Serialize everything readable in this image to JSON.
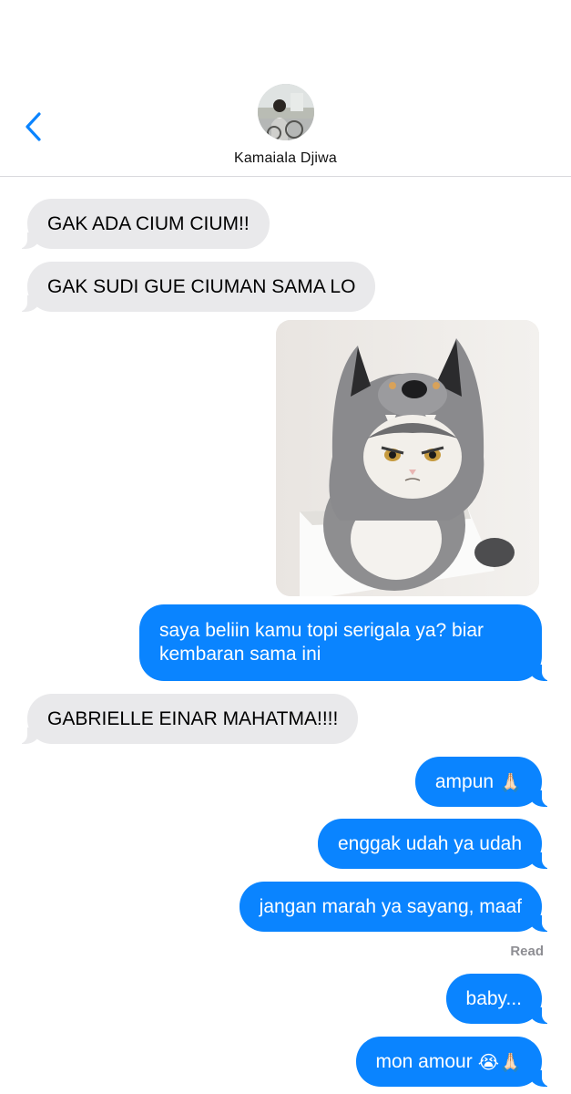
{
  "header": {
    "contact_name": "Kamaiala Djiwa",
    "back_icon": "chevron-left-icon",
    "accent_color": "#0a84ff"
  },
  "messages": [
    {
      "direction": "incoming",
      "text": "GAK ADA CIUM CIUM!!"
    },
    {
      "direction": "incoming",
      "text": "GAK SUDI GUE CIUMAN SAMA LO"
    },
    {
      "direction": "outgoing",
      "type": "image",
      "description": "cat-in-wolf-hat-photo"
    },
    {
      "direction": "outgoing",
      "text": "saya beliin kamu topi serigala ya? biar kembaran sama ini"
    },
    {
      "direction": "incoming",
      "text": "GABRIELLE EINAR MAHATMA!!!!"
    },
    {
      "direction": "outgoing",
      "text": "ampun",
      "emoji": "🙏🏻"
    },
    {
      "direction": "outgoing",
      "text": "enggak udah ya udah"
    },
    {
      "direction": "outgoing",
      "text": "jangan marah ya sayang, maaf"
    },
    {
      "direction": "outgoing",
      "text": "baby..."
    },
    {
      "direction": "outgoing",
      "text": "mon amour",
      "emoji": "😭🙏🏻"
    }
  ],
  "read_receipt": "Read",
  "colors": {
    "incoming_bubble": "#e9e9eb",
    "outgoing_bubble": "#0a84ff"
  }
}
